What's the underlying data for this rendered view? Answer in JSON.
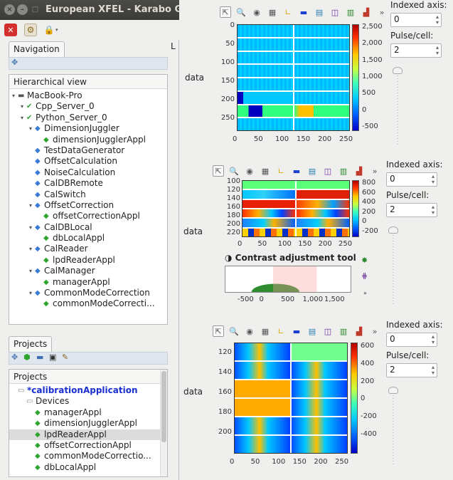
{
  "window": {
    "title": "European XFEL - Karabo GUI",
    "buttons": [
      "×",
      "–",
      "□"
    ]
  },
  "toolbar": {
    "icons": [
      "close-red-icon",
      "gears-icon",
      "lock-icon"
    ]
  },
  "navigation": {
    "tab_label": "Navigation",
    "header": "Hierarchical view",
    "items": [
      {
        "label": "MacBook-Pro",
        "level": 0,
        "icon": "computer-icon",
        "expanded": true
      },
      {
        "label": "Cpp_Server_0",
        "level": 1,
        "icon": "check-icon",
        "expanded": true
      },
      {
        "label": "Python_Server_0",
        "level": 1,
        "icon": "check-icon",
        "expanded": true
      },
      {
        "label": "DimensionJuggler",
        "level": 2,
        "icon": "class-icon",
        "expanded": true
      },
      {
        "label": "dimensionJugglerAppl",
        "level": 3,
        "icon": "device-icon"
      },
      {
        "label": "TestDataGenerator",
        "level": 2,
        "icon": "class-icon"
      },
      {
        "label": "OffsetCalculation",
        "level": 2,
        "icon": "class-icon"
      },
      {
        "label": "NoiseCalculation",
        "level": 2,
        "icon": "class-icon"
      },
      {
        "label": "CalDBRemote",
        "level": 2,
        "icon": "class-icon"
      },
      {
        "label": "CalSwitch",
        "level": 2,
        "icon": "class-icon"
      },
      {
        "label": "OffsetCorrection",
        "level": 2,
        "icon": "class-icon",
        "expanded": true
      },
      {
        "label": "offsetCorrectionAppl",
        "level": 3,
        "icon": "device-icon"
      },
      {
        "label": "CalDBLocal",
        "level": 2,
        "icon": "class-icon",
        "expanded": true
      },
      {
        "label": "dbLocalAppl",
        "level": 3,
        "icon": "device-icon"
      },
      {
        "label": "CalReader",
        "level": 2,
        "icon": "class-icon",
        "expanded": true
      },
      {
        "label": "lpdReaderAppl",
        "level": 3,
        "icon": "device-icon"
      },
      {
        "label": "CalManager",
        "level": 2,
        "icon": "class-icon",
        "expanded": true
      },
      {
        "label": "managerAppl",
        "level": 3,
        "icon": "device-icon"
      },
      {
        "label": "CommonModeCorrection",
        "level": 2,
        "icon": "class-icon",
        "expanded": true
      },
      {
        "label": "commonModeCorrecti...",
        "level": 3,
        "icon": "device-icon"
      }
    ]
  },
  "projects": {
    "tab_label": "Projects",
    "header": "Projects",
    "toolbar_icons": [
      "new-project-icon",
      "open-project-icon",
      "save-icon",
      "save-as-icon",
      "edit-icon"
    ],
    "items": [
      {
        "label": "*calibrationApplication",
        "level": 0,
        "icon": "folder-icon",
        "bold": true
      },
      {
        "label": "Devices",
        "level": 1,
        "icon": "folder-icon"
      },
      {
        "label": "managerAppl",
        "level": 2,
        "icon": "device-icon"
      },
      {
        "label": "dimensionJugglerAppl",
        "level": 2,
        "icon": "device-icon"
      },
      {
        "label": "lpdReaderAppl",
        "level": 2,
        "icon": "device-icon",
        "selected": true
      },
      {
        "label": "offsetCorrectionAppl",
        "level": 2,
        "icon": "device-icon"
      },
      {
        "label": "commonModeCorrectio...",
        "level": 2,
        "icon": "device-icon"
      },
      {
        "label": "dbLocalAppl",
        "level": 2,
        "icon": "device-icon"
      }
    ]
  },
  "plots": [
    {
      "data_label": "data",
      "side": {
        "indexed_axis_label": "Indexed axis:",
        "indexed_axis_value": "0",
        "pulse_label": "Pulse/cell:",
        "pulse_value": "2",
        "slider_level": 0
      },
      "y_ticks": [
        "0",
        "50",
        "100",
        "150",
        "200",
        "250"
      ],
      "x_ticks": [
        "0",
        "50",
        "100",
        "150",
        "200",
        "250"
      ],
      "cbar_ticks": [
        "2,500",
        "2,000",
        "1,500",
        "1,000",
        "500",
        "0",
        "-500"
      ]
    },
    {
      "data_label": "data",
      "side": {
        "indexed_axis_label": "Indexed axis:",
        "indexed_axis_value": "0",
        "pulse_label": "Pulse/cell:",
        "pulse_value": "2",
        "slider_level": 0
      },
      "y_ticks": [
        "100",
        "120",
        "140",
        "160",
        "180",
        "200",
        "220"
      ],
      "x_ticks": [
        "0",
        "50",
        "100",
        "150",
        "200",
        "250"
      ],
      "cbar_ticks": [
        "800",
        "600",
        "400",
        "200",
        "0",
        "-200"
      ],
      "contrast_tool": {
        "title": "Contrast adjustment tool",
        "x_ticks": [
          "-500",
          "0",
          "500",
          "1,000",
          "1,500"
        ]
      }
    },
    {
      "data_label": "data",
      "side": {
        "indexed_axis_label": "Indexed axis:",
        "indexed_axis_value": "0",
        "pulse_label": "Pulse/cell:",
        "pulse_value": "2",
        "slider_level": 0
      },
      "y_ticks": [
        "120",
        "140",
        "160",
        "180",
        "200"
      ],
      "x_ticks": [
        "0",
        "50",
        "100",
        "150",
        "200",
        "250"
      ],
      "cbar_ticks": [
        "600",
        "400",
        "200",
        "0",
        "-200",
        "-400"
      ]
    }
  ],
  "plot_toolbar_icons": [
    "pointer-icon",
    "zoom-icon",
    "roi-icon",
    "grid-icon",
    "axes-icon",
    "colormap-icon",
    "export-icon",
    "aux-plot-icon",
    "histogram-icon",
    "roi-tool-icon",
    "more-icon"
  ],
  "colors": {
    "accent": "#3c3b37",
    "check": "#2fa52f",
    "class_icon": "#3a7bd5",
    "device_icon": "#2fa52f",
    "project_link": "#1a2fd0"
  },
  "hidden_tab_letter": "L"
}
